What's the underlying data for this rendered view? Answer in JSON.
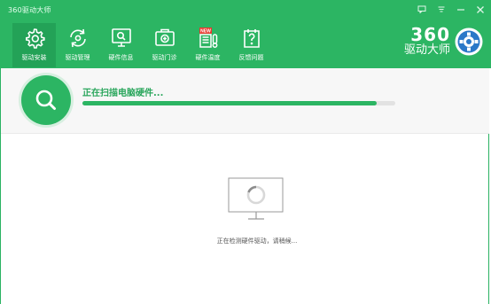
{
  "window": {
    "title": "360驱动大师"
  },
  "nav": [
    {
      "id": "driver-install",
      "label": "驱动安装",
      "active": true,
      "icon": "gear-icon"
    },
    {
      "id": "driver-manage",
      "label": "驱动管理",
      "active": false,
      "icon": "refresh-icon"
    },
    {
      "id": "hardware-info",
      "label": "硬件信息",
      "active": false,
      "icon": "monitor-search-icon"
    },
    {
      "id": "driver-gate",
      "label": "驱动门诊",
      "active": false,
      "icon": "medical-kit-icon"
    },
    {
      "id": "hardware-temp",
      "label": "硬件温度",
      "active": false,
      "icon": "thermometer-icon",
      "badge": "NEW"
    },
    {
      "id": "feedback",
      "label": "反馈问题",
      "active": false,
      "icon": "question-icon"
    }
  ],
  "logo": {
    "number": "360",
    "name": "驱动大师"
  },
  "scan": {
    "status": "正在扫描电脑硬件...",
    "progress": 0.94
  },
  "main": {
    "detecting_text": "正在检测硬件驱动，请稍候..."
  },
  "colors": {
    "brand": "#2cb563",
    "active_tab": "#23a257",
    "progress_track": "#e2e2e2"
  }
}
